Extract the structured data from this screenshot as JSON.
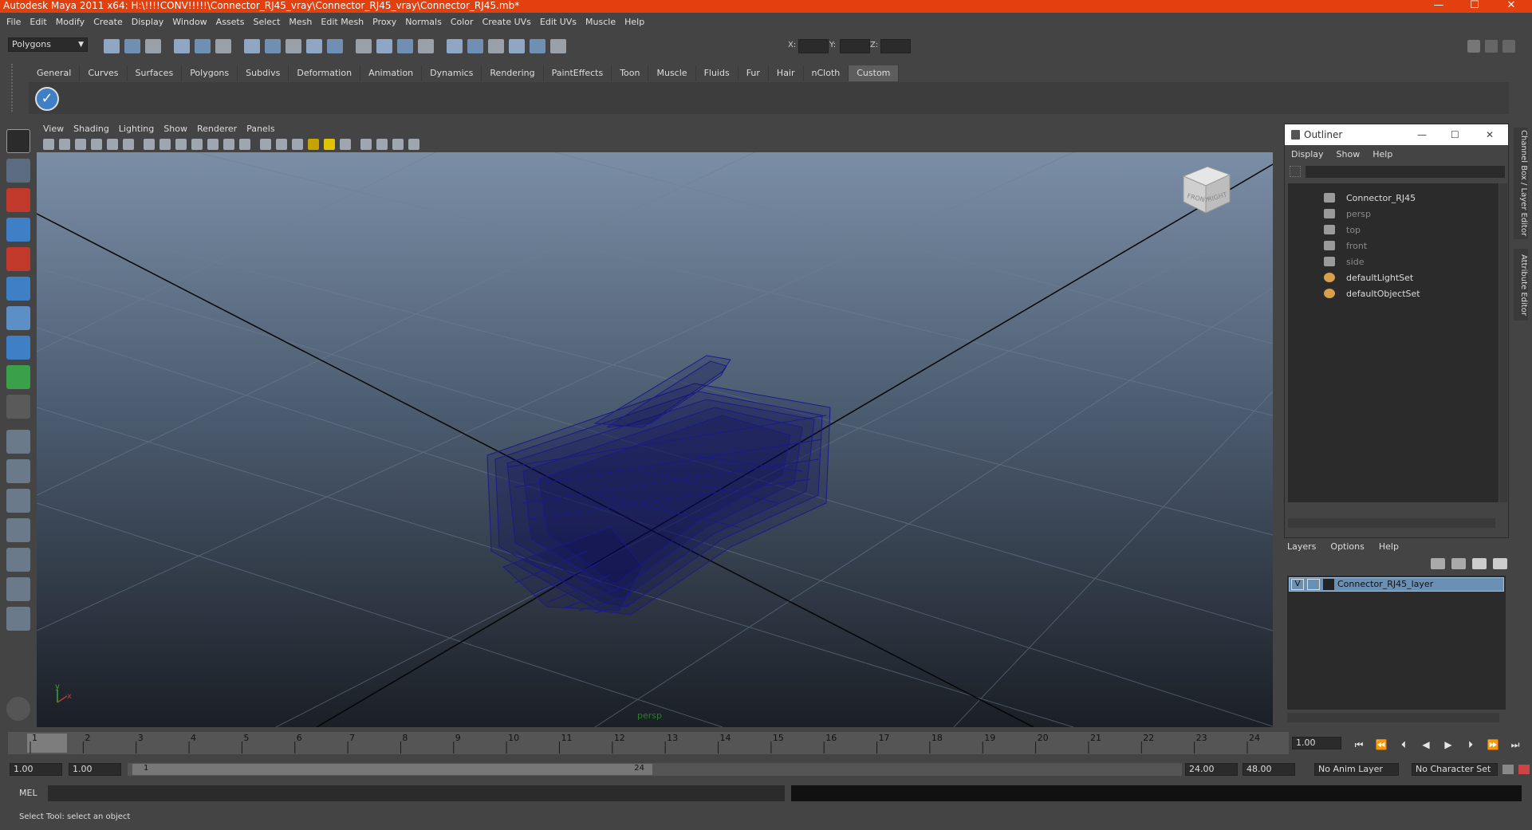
{
  "window": {
    "title": "Autodesk Maya 2011 x64: H:\\!!!!CONV!!!!!\\Connector_RJ45_vray\\Connector_RJ45_vray\\Connector_RJ45.mb*",
    "accent_color": "#e2400f"
  },
  "menubar": [
    "File",
    "Edit",
    "Modify",
    "Create",
    "Display",
    "Window",
    "Assets",
    "Select",
    "Mesh",
    "Edit Mesh",
    "Proxy",
    "Normals",
    "Color",
    "Create UVs",
    "Edit UVs",
    "Muscle",
    "Help"
  ],
  "statusline": {
    "mode": "Polygons",
    "x_label": "X:",
    "y_label": "Y:",
    "z_label": "Z:"
  },
  "shelf": {
    "tabs": [
      "General",
      "Curves",
      "Surfaces",
      "Polygons",
      "Subdivs",
      "Deformation",
      "Animation",
      "Dynamics",
      "Rendering",
      "PaintEffects",
      "Toon",
      "Muscle",
      "Fluids",
      "Fur",
      "Hair",
      "nCloth",
      "Custom"
    ],
    "active_tab": "Custom"
  },
  "viewport": {
    "menu": [
      "View",
      "Shading",
      "Lighting",
      "Show",
      "Renderer",
      "Panels"
    ],
    "camera_label": "persp",
    "viewcube_front": "FRONT",
    "viewcube_right": "RIGHT",
    "axis_x": "x",
    "axis_y": "y",
    "wire_color": "#1a1a8c"
  },
  "outliner": {
    "title": "Outliner",
    "menu": [
      "Display",
      "Show",
      "Help"
    ],
    "items": [
      {
        "label": "Connector_RJ45",
        "icon": "transform-icon",
        "dim": false
      },
      {
        "label": "persp",
        "icon": "camera-icon",
        "dim": true
      },
      {
        "label": "top",
        "icon": "camera-icon",
        "dim": true
      },
      {
        "label": "front",
        "icon": "camera-icon",
        "dim": true
      },
      {
        "label": "side",
        "icon": "camera-icon",
        "dim": true
      },
      {
        "label": "defaultLightSet",
        "icon": "set-icon",
        "dim": false
      },
      {
        "label": "defaultObjectSet",
        "icon": "set-icon",
        "dim": false
      }
    ]
  },
  "layers": {
    "menu": [
      "Layers",
      "Options",
      "Help"
    ],
    "layer": {
      "visible": "V",
      "name": "Connector_RJ45_layer"
    },
    "selected_color": "#6a90b6"
  },
  "side_tabs": [
    "Channel Box / Layer Editor",
    "Attribute Editor"
  ],
  "timeline": {
    "ticks": [
      "1",
      "2",
      "3",
      "4",
      "5",
      "6",
      "7",
      "8",
      "9",
      "10",
      "11",
      "12",
      "13",
      "14",
      "15",
      "16",
      "17",
      "18",
      "19",
      "20",
      "21",
      "22",
      "23",
      "24"
    ],
    "current_frame": "1.00",
    "range_start": "1.00",
    "range_inner_start": "1.00",
    "range_slider_start": "1",
    "range_slider_end": "24",
    "range_end": "24.00",
    "range_outer_end": "48.00",
    "anim_layer": "No Anim Layer",
    "character_set": "No Character Set"
  },
  "commandline": {
    "label": "MEL"
  },
  "helpline": {
    "text": "Select Tool: select an object"
  }
}
